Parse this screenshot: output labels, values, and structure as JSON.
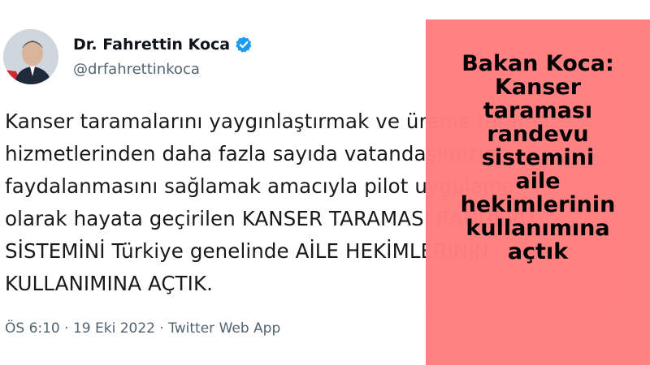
{
  "author": {
    "name": "Dr. Fahrettin Koca",
    "handle": "@drfahrettinkoca",
    "verified_icon": "verified-badge-icon",
    "verified_color": "#1d9bf0"
  },
  "tweet": {
    "lines": [
      "Kanser taramalarını yaygınlaştırmak ve üreme tarama",
      "hizmetlerinden daha fazla sayıda vatandaşımızın",
      "faydalanmasını sağlamak amacıyla pilot uygulama",
      "olarak hayata geçirilen KANSER TARAMASI RANDEVU",
      "SİSTEMİNİ Türkiye genelinde AİLE HEKİMLERİNİN",
      "KULLANIMINA AÇTIK."
    ],
    "meta": "ÖS 6:10 · 19 Eki 2022 · Twitter Web App"
  },
  "overlay": {
    "background": "#ff7f80",
    "headline_lines": [
      "Bakan Koca:",
      "Kanser",
      "taraması",
      "randevu",
      "sistemini",
      "aile",
      "hekimlerinin",
      "kullanımına",
      "açtık"
    ]
  }
}
